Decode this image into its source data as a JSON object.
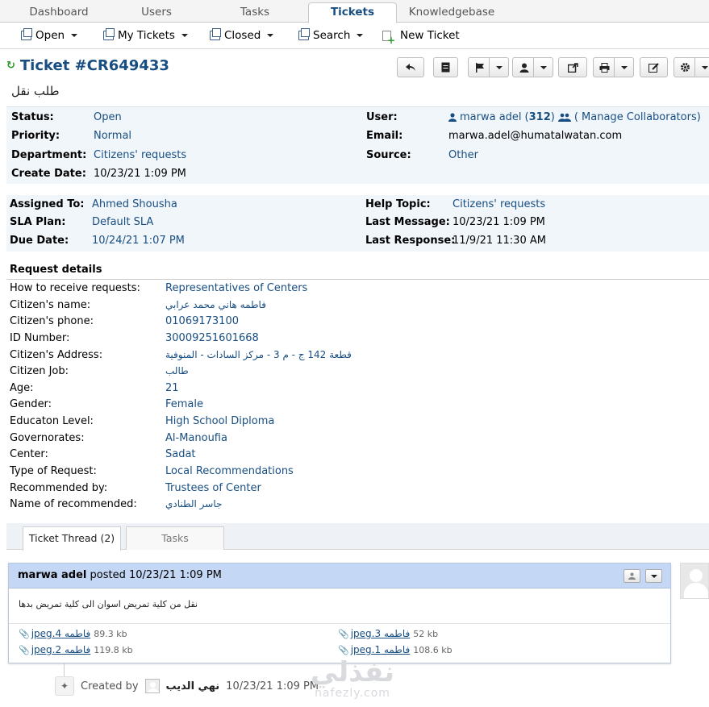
{
  "topnav": {
    "tabs": [
      "Dashboard",
      "Users",
      "Tasks",
      "Tickets",
      "Knowledgebase"
    ],
    "active": "Tickets"
  },
  "subnav": {
    "open": "Open",
    "my_tickets": "My Tickets",
    "closed": "Closed",
    "search": "Search",
    "new_ticket": "New Ticket"
  },
  "ticket": {
    "title": "Ticket #CR649433",
    "subject": "طلب نقل",
    "toolbar_icons": [
      "reply-icon",
      "note-icon",
      "flag-icon",
      "assign-icon",
      "transfer-icon",
      "print-icon",
      "edit-icon",
      "settings-icon"
    ]
  },
  "info1": {
    "status_label": "Status:",
    "status": "Open",
    "priority_label": "Priority:",
    "priority": "Normal",
    "department_label": "Department:",
    "department": "Citizens' requests",
    "create_date_label": "Create Date:",
    "create_date": "10/23/21 1:09 PM",
    "user_label": "User:",
    "user": "marwa adel",
    "user_count_open": "(",
    "user_count": "312",
    "user_count_close": ")",
    "manage_collab": "( Manage Collaborators)",
    "email_label": "Email:",
    "email": "marwa.adel@humatalwatan.com",
    "source_label": "Source:",
    "source": "Other"
  },
  "info2": {
    "assigned_label": "Assigned To:",
    "assigned": "Ahmed Shousha",
    "sla_label": "SLA Plan:",
    "sla": "Default SLA",
    "due_label": "Due Date:",
    "due": "10/24/21 1:07 PM",
    "help_topic_label": "Help Topic:",
    "help_topic": "Citizens' requests",
    "last_message_label": "Last Message:",
    "last_message": "10/23/21 1:09 PM",
    "last_response_label": "Last Response:",
    "last_response": "11/9/21 11:30 AM"
  },
  "request_details": {
    "title": "Request details",
    "rows": [
      {
        "k": "How to receive requests:",
        "v": "Representatives of Centers"
      },
      {
        "k": "Citizen's name:",
        "v": "فاطمه هاني محمد عرابي"
      },
      {
        "k": "Citizen's phone:",
        "v": "01069173100"
      },
      {
        "k": "ID Number:",
        "v": "30009251601668"
      },
      {
        "k": "Citizen's Address:",
        "v": "قطعة 142 ج - م 3 - مركز السادات - المنوفية"
      },
      {
        "k": "Citizen Job:",
        "v": "طالب"
      },
      {
        "k": "Age:",
        "v": "21"
      },
      {
        "k": "Gender:",
        "v": "Female"
      },
      {
        "k": "Educaton Level:",
        "v": "High School Diploma"
      },
      {
        "k": "Governorates:",
        "v": "Al-Manoufia"
      },
      {
        "k": "Center:",
        "v": "Sadat"
      },
      {
        "k": "Type of Request:",
        "v": "Local Recommendations"
      },
      {
        "k": "Recommended by:",
        "v": "Trustees of Center"
      },
      {
        "k": "Name of recommended:",
        "v": "جاسر الطنادي"
      }
    ]
  },
  "thread_tabs": {
    "thread": "Ticket Thread (2)",
    "tasks": "Tasks"
  },
  "message": {
    "author": "marwa adel",
    "posted": "posted 10/23/21 1:09 PM",
    "body": "نقل من كلية تمريض اسوان الى كلية تمريض بدها",
    "attachments": [
      {
        "name": "فاطمه 4.jpeg",
        "size": "89.3 kb"
      },
      {
        "name": "فاطمه 3.jpeg",
        "size": "52 kb"
      },
      {
        "name": "فاطمه 2.jpeg",
        "size": "119.8 kb"
      },
      {
        "name": "فاطمه 1.jpeg",
        "size": "108.6 kb"
      }
    ]
  },
  "event": {
    "created_by": "Created by",
    "who": "نهي الديب",
    "when": "10/23/21 1:09 PM"
  },
  "watermark": {
    "ar": "نفذلي",
    "en": "nafezly.com"
  }
}
